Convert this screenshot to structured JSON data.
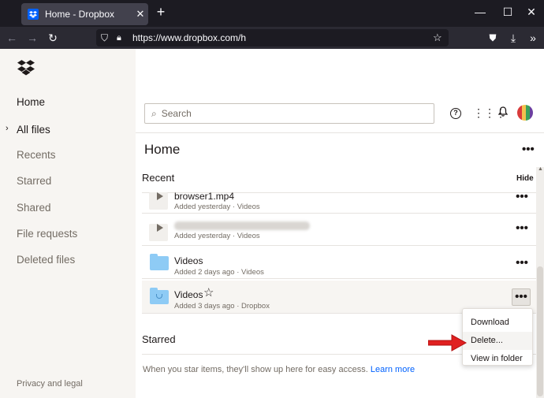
{
  "browser": {
    "tab_title": "Home - Dropbox",
    "new_tab": "+",
    "url": "https://www.dropbox.com/h"
  },
  "sidebar": {
    "items": [
      {
        "label": "Home"
      },
      {
        "label": "All files"
      },
      {
        "label": "Recents"
      },
      {
        "label": "Starred"
      },
      {
        "label": "Shared"
      },
      {
        "label": "File requests"
      },
      {
        "label": "Deleted files"
      }
    ],
    "footer": "Privacy and legal"
  },
  "main": {
    "search_placeholder": "Search",
    "page_title": "Home",
    "recent_heading": "Recent",
    "hide_label": "Hide",
    "files": [
      {
        "name": "browser1.mp4",
        "meta": "Added yesterday · Videos"
      },
      {
        "name": "",
        "meta": "Added yesterday · Videos"
      },
      {
        "name": "Videos",
        "meta": "Added 2 days ago · Videos"
      },
      {
        "name": "Videos",
        "meta": "Added 3 days ago · Dropbox"
      }
    ],
    "starred_heading": "Starred",
    "starred_empty": "When you star items, they'll show up here for easy access.",
    "learn_more": "Learn more"
  },
  "context_menu": {
    "items": [
      "Download",
      "Delete...",
      "View in folder"
    ]
  },
  "colors": {
    "accent": "#0061fe",
    "link": "#0061fe",
    "annotation_arrow": "#e02020"
  }
}
